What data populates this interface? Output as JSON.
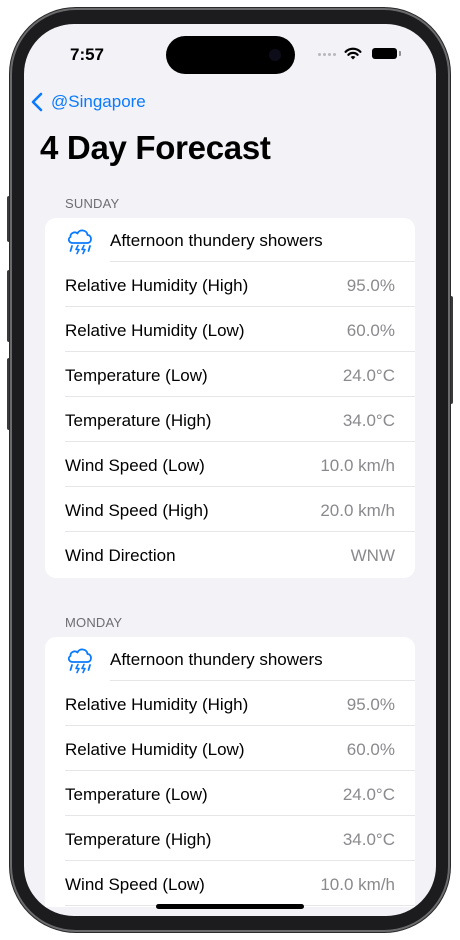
{
  "status": {
    "time": "7:57"
  },
  "nav": {
    "back_label": "@Singapore"
  },
  "page": {
    "title": "4 Day Forecast"
  },
  "days": [
    {
      "name": "SUNDAY",
      "condition": "Afternoon thundery showers",
      "icon": "cloud-bolt-rain-icon",
      "rows": [
        {
          "label": "Relative Humidity (High)",
          "value": "95.0%"
        },
        {
          "label": "Relative Humidity (Low)",
          "value": "60.0%"
        },
        {
          "label": "Temperature (Low)",
          "value": "24.0°C"
        },
        {
          "label": "Temperature (High)",
          "value": "34.0°C"
        },
        {
          "label": "Wind Speed (Low)",
          "value": "10.0 km/h"
        },
        {
          "label": "Wind Speed (High)",
          "value": "20.0 km/h"
        },
        {
          "label": "Wind Direction",
          "value": "WNW"
        }
      ]
    },
    {
      "name": "MONDAY",
      "condition": "Afternoon thundery showers",
      "icon": "cloud-bolt-rain-icon",
      "rows": [
        {
          "label": "Relative Humidity (High)",
          "value": "95.0%"
        },
        {
          "label": "Relative Humidity (Low)",
          "value": "60.0%"
        },
        {
          "label": "Temperature (Low)",
          "value": "24.0°C"
        },
        {
          "label": "Temperature (High)",
          "value": "34.0°C"
        },
        {
          "label": "Wind Speed (Low)",
          "value": "10.0 km/h"
        }
      ]
    }
  ],
  "colors": {
    "accent": "#0a7aff",
    "background": "#f2f2f7",
    "value_text": "#8a8a8e"
  }
}
